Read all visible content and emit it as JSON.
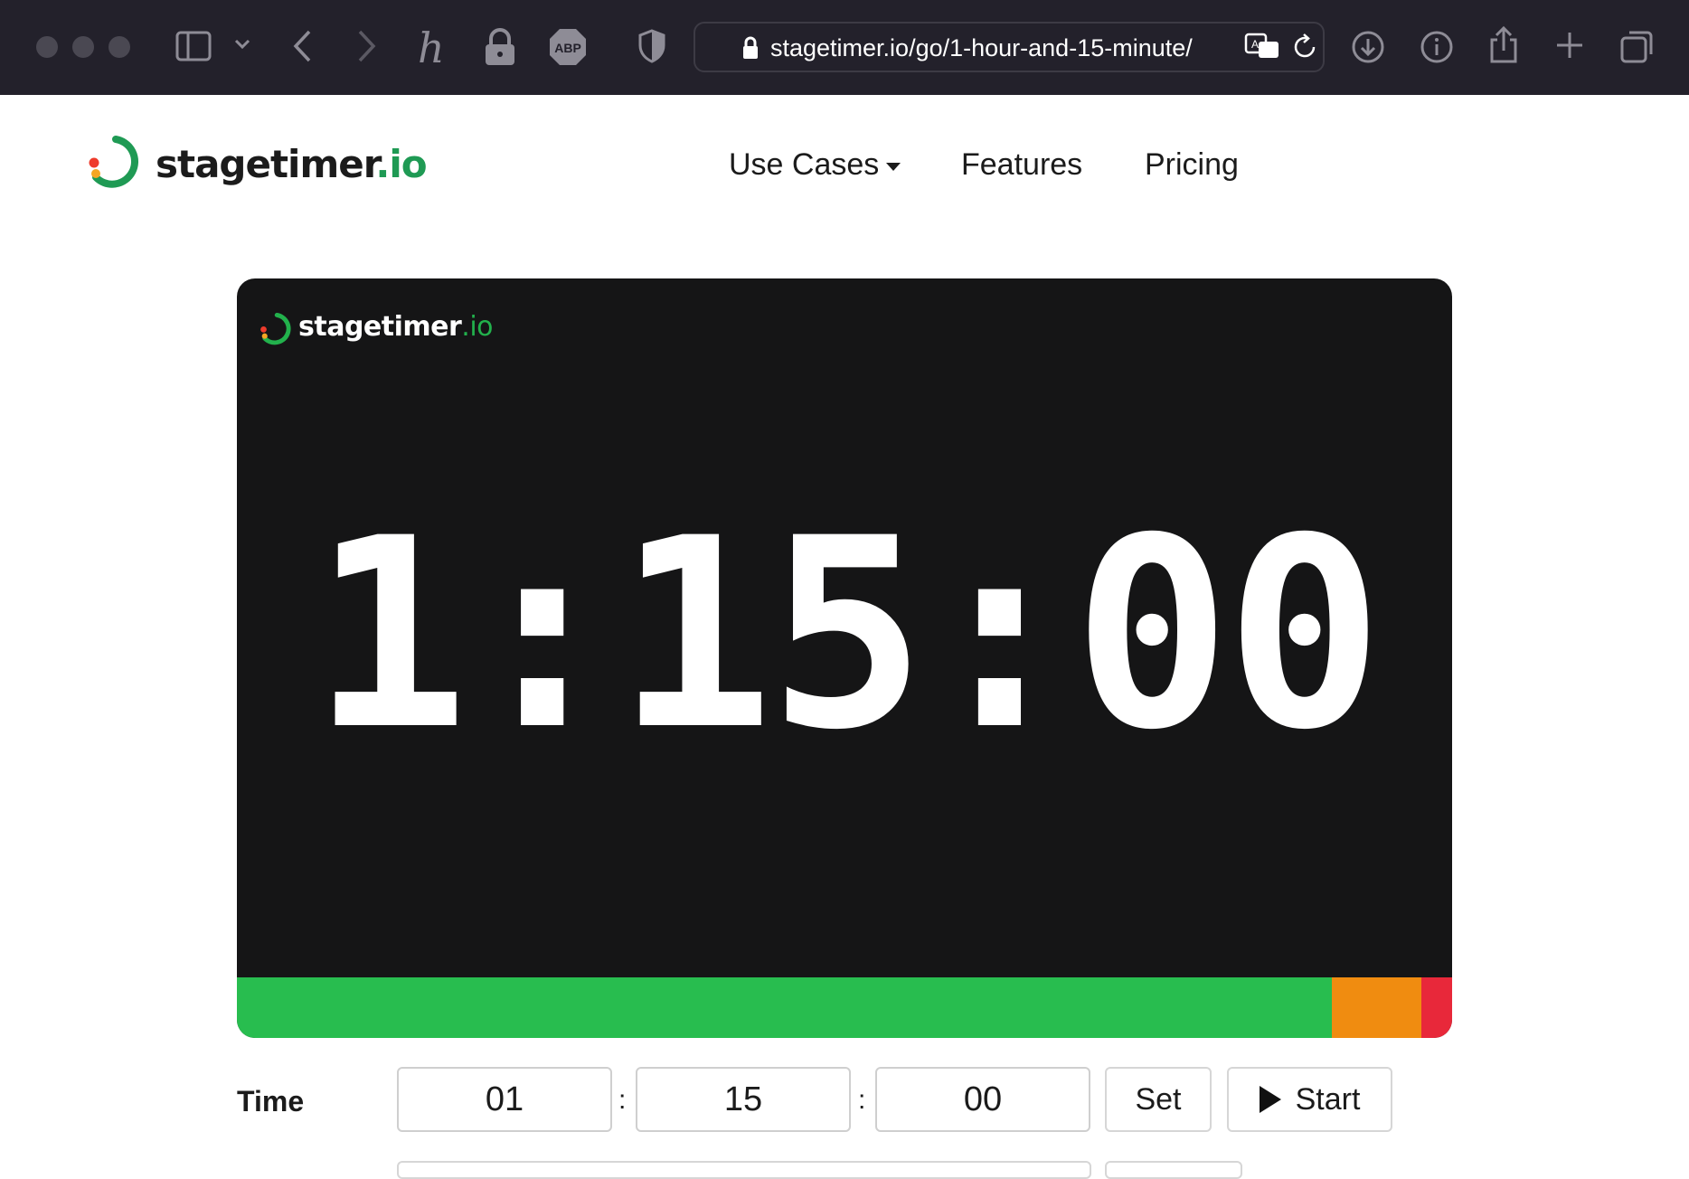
{
  "browser": {
    "url": "stagetimer.io/go/1-hour-and-15-minute/",
    "icons": [
      "sidebar-icon",
      "chevron-down-icon",
      "back-icon",
      "forward-icon",
      "honey-extension-icon",
      "lock-extension-icon",
      "adblock-plus-icon",
      "shield-icon",
      "lock-icon",
      "translate-icon",
      "reload-icon",
      "download-icon",
      "info-icon",
      "share-icon",
      "new-tab-icon",
      "tab-overview-icon"
    ],
    "abp_text": "ABP"
  },
  "site": {
    "brand_name": "stagetimer",
    "brand_tld": ".io",
    "nav": {
      "use_cases": "Use Cases",
      "features": "Features",
      "pricing": "Pricing"
    }
  },
  "timer": {
    "brand_name": "stagetimer",
    "brand_tld": ".io",
    "display": "1:15:00",
    "progress_segments": [
      {
        "name": "green",
        "fraction": 0.901,
        "color": "#28bd4f"
      },
      {
        "name": "orange",
        "fraction": 0.074,
        "color": "#f08c10"
      },
      {
        "name": "red",
        "fraction": 0.025,
        "color": "#e8283a"
      }
    ]
  },
  "controls": {
    "time_label": "Time",
    "hours": "01",
    "minutes": "15",
    "seconds": "00",
    "separator": ":",
    "set_label": "Set",
    "start_label": "Start"
  },
  "colors": {
    "brand_green": "#1f9a54",
    "panel_bg": "#151516",
    "chrome_bg": "#23212b"
  }
}
